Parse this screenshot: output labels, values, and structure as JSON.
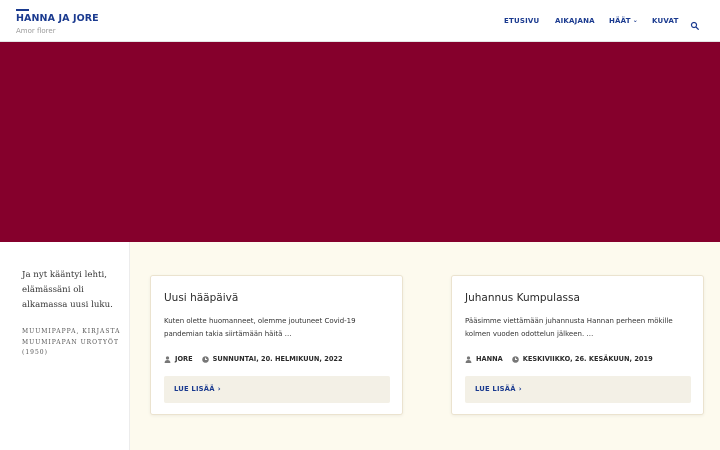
{
  "site": {
    "title": "HANNA JA JORE",
    "tagline": "Amor florer"
  },
  "nav": {
    "items": [
      {
        "label": "ETUSIVU"
      },
      {
        "label": "AIKAJANA"
      },
      {
        "label": "HÄÄT"
      },
      {
        "label": "KUVAT"
      }
    ],
    "search_icon": "search-icon"
  },
  "colors": {
    "brand": "#1a3a8f",
    "hero": "#85002c",
    "content_bg": "#fdfaee"
  },
  "quote": {
    "text": "Ja nyt kääntyi lehti, elämässäni oli alkamassa uusi luku.",
    "source": "Muumipappa, kirjasta Muumipapan urotyöt (1950)"
  },
  "posts": [
    {
      "title": "Uusi hääpäivä",
      "excerpt": "Kuten olette huomanneet, olemme joutuneet Covid-19 pandemian takia siirtämään häitä …",
      "author": "JORE",
      "date": "SUNNUNTAI, 20. HELMIKUUN, 2022",
      "read_more": "LUE LISÄÄ"
    },
    {
      "title": "Juhannus Kumpulassa",
      "excerpt": "Pääsimme viettämään juhannusta Hannan perheen mökille kolmen vuoden odottelun jälkeen. …",
      "author": "HANNA",
      "date": "KESKIVIIKKO, 26. KESÄKUUN, 2019",
      "read_more": "LUE LISÄÄ"
    }
  ]
}
